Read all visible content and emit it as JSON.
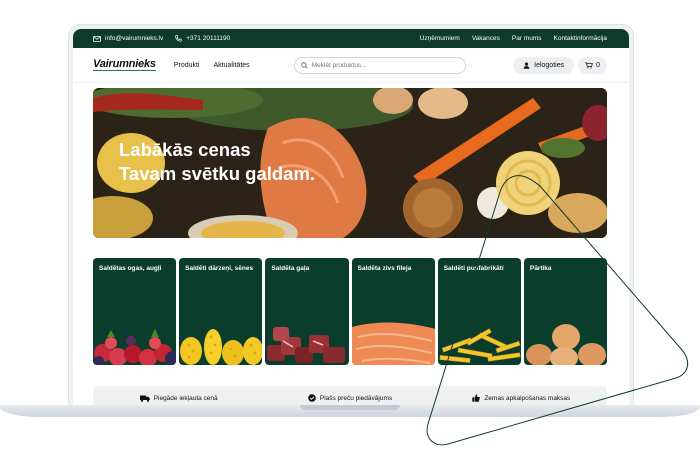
{
  "topbar": {
    "email": "info@vairumnieks.lv",
    "phone": "+371 20111190",
    "links": [
      "Uzņēmumiem",
      "Vakances",
      "Par mums",
      "Kontaktinformācija"
    ]
  },
  "header": {
    "logo": "Vairumnieks",
    "nav": [
      "Produkti",
      "Aktualitātes"
    ],
    "search_placeholder": "Meklēt produktus...",
    "login_label": "Ielogoties",
    "cart_count": "0"
  },
  "hero": {
    "line1": "Labākās cenas",
    "line2": "Tavam svētku galdam."
  },
  "categories": [
    {
      "label": "Saldētas ogas, augļi",
      "icon": "berries-image"
    },
    {
      "label": "Saldēti dārzeņi, sēnes",
      "icon": "corn-image"
    },
    {
      "label": "Saldēta gaļa",
      "icon": "meat-image"
    },
    {
      "label": "Saldēta zivs fileja",
      "icon": "salmon-image"
    },
    {
      "label": "Saldēti pusfabrikāti",
      "icon": "fries-image"
    },
    {
      "label": "Pārtika",
      "icon": "eggs-image"
    }
  ],
  "benefits": [
    {
      "label": "Piegāde iekļauta cenā",
      "icon": "truck-icon"
    },
    {
      "label": "Plašs preču piedāvājums",
      "icon": "check-circle-icon"
    },
    {
      "label": "Zemas apkalpošanas maksas",
      "icon": "thumbs-up-icon"
    }
  ],
  "colors": {
    "brand_dark_green": "#0d3b2b",
    "card_green": "#0b3d2c",
    "accent_green": "#1f7a4d"
  }
}
